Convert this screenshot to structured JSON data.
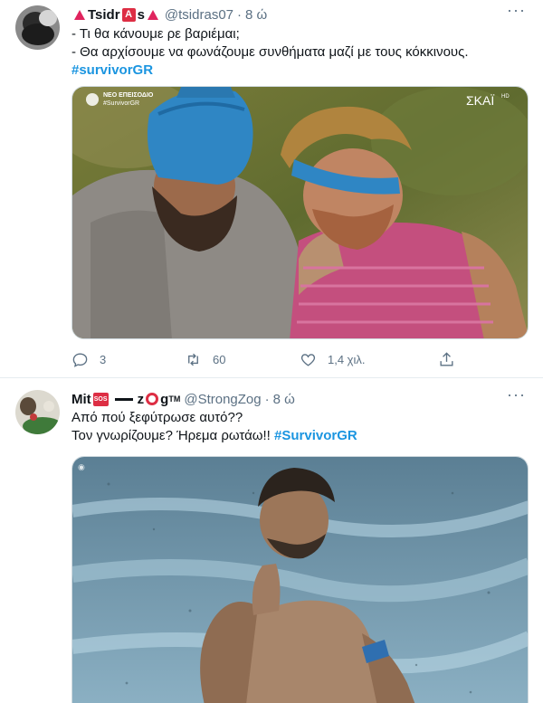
{
  "tweets": [
    {
      "display_name_part1": "Tsidr",
      "display_name_emoji_letter": "A",
      "display_name_part2": "s",
      "handle": "@tsidras07",
      "separator": "·",
      "time": "8 ώ",
      "lines": [
        "- Τι θα κάνουμε ρε βαριέμαι;",
        "- Θα αρχίσουμε να φωνάζουμε συνθήματα μαζί με τους κόκκινους."
      ],
      "hashtag": "#survivorGR",
      "media": {
        "overlay_badge": "NEO ΕΠΕΙΣΟΔΙΟ",
        "overlay_tag": "#SurvivorGR",
        "channel_logo": "ΣΚΑΪ",
        "channel_logo_sup": "HD"
      },
      "actions": {
        "reply_count": "3",
        "retweet_count": "60",
        "like_count": "1,4 χιλ."
      }
    },
    {
      "display_name_part1": "Mit",
      "display_name_emoji_sos": "SOS",
      "display_name_part2": "z",
      "display_name_part3": "g",
      "display_name_tm": "TM",
      "handle": "@StrongZog",
      "separator": "·",
      "time": "8 ώ",
      "line1": "Από πού ξεφύτρωσε αυτό??",
      "line2_text": "Τον γνωρίζουμε? Ήρεμα ρωτάω!! ",
      "hashtag": "#SurvivorGR"
    }
  ],
  "colors": {
    "hashtag": "#1b95e0",
    "secondary_text": "#5b7083",
    "divider": "#e6ecf0",
    "emoji_red": "#dd2e44"
  },
  "icons": {
    "reply": "reply-icon",
    "retweet": "retweet-icon",
    "like": "like-icon",
    "share": "share-icon",
    "more": "more-icon"
  }
}
